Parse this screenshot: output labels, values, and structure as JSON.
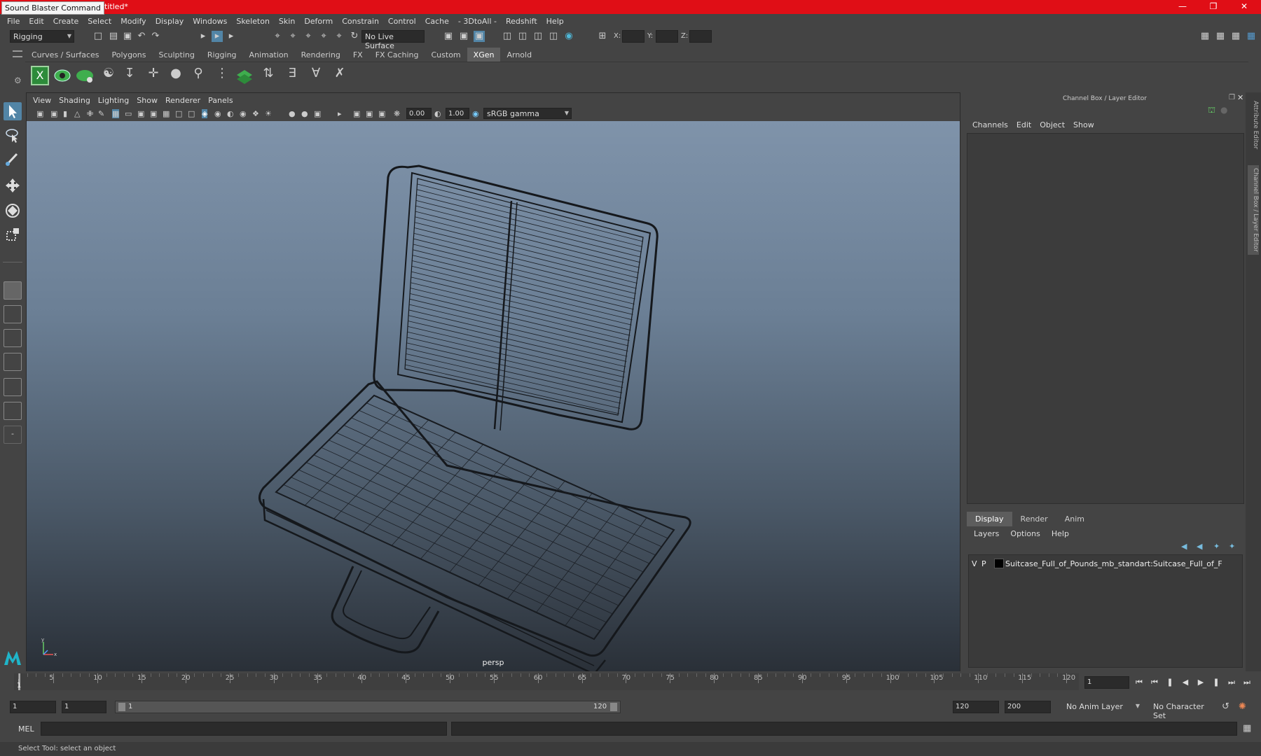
{
  "window": {
    "tooltip": "Sound Blaster Command",
    "title_fragment": "untitled*"
  },
  "menubar": [
    "File",
    "Edit",
    "Create",
    "Select",
    "Modify",
    "Display",
    "Windows",
    "Skeleton",
    "Skin",
    "Deform",
    "Constrain",
    "Control",
    "Cache",
    "- 3DtoAll -",
    "Redshift",
    "Help"
  ],
  "statusline": {
    "menuset": "Rigging",
    "live_surface": "No Live Surface",
    "x_label": "X:",
    "y_label": "Y:",
    "z_label": "Z:"
  },
  "shelf": {
    "tabs": [
      "Curves / Surfaces",
      "Polygons",
      "Sculpting",
      "Rigging",
      "Animation",
      "Rendering",
      "FX",
      "FX Caching",
      "Custom",
      "XGen",
      "Arnold"
    ],
    "active_tab": "XGen"
  },
  "viewport": {
    "menu": [
      "View",
      "Shading",
      "Lighting",
      "Show",
      "Renderer",
      "Panels"
    ],
    "exposure": "0.00",
    "gamma": "1.00",
    "color_space": "sRGB gamma",
    "camera": "persp"
  },
  "channel_box": {
    "title": "Channel Box / Layer Editor",
    "menu": [
      "Channels",
      "Edit",
      "Object",
      "Show"
    ],
    "layer_tabs": [
      "Display",
      "Render",
      "Anim"
    ],
    "active_layer_tab": "Display",
    "layer_menu": [
      "Layers",
      "Options",
      "Help"
    ],
    "layer": {
      "v": "V",
      "p": "P",
      "name": "Suitcase_Full_of_Pounds_mb_standart:Suitcase_Full_of_F"
    }
  },
  "side_tabs": [
    "Attribute Editor",
    "Channel Box / Layer Editor"
  ],
  "timeline": {
    "ticks": [
      1,
      5,
      10,
      15,
      20,
      25,
      30,
      35,
      40,
      45,
      50,
      55,
      60,
      65,
      70,
      75,
      80,
      85,
      90,
      95,
      100,
      105,
      110,
      115,
      120
    ],
    "current_frame": "1"
  },
  "range": {
    "start": "1",
    "anim_start": "1",
    "slider_start": "1",
    "slider_end": "120",
    "anim_end": "120",
    "end": "200",
    "anim_layer": "No Anim Layer",
    "character_set": "No Character Set"
  },
  "command_line": {
    "language": "MEL"
  },
  "help_line": "Select Tool: select an object",
  "colors": {
    "titlebar": "#e00e16",
    "panel": "#444444",
    "active_tab": "#5d5d5d",
    "shelf_green": "#3fae4e"
  }
}
